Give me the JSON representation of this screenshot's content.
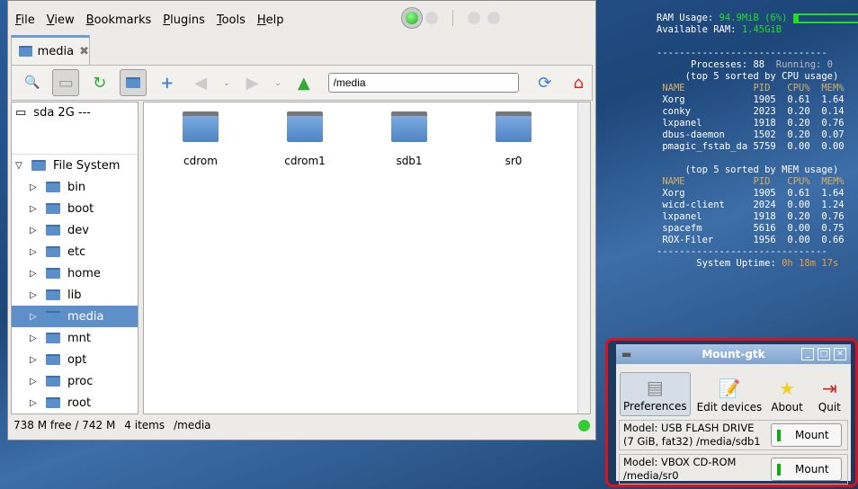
{
  "filemanager": {
    "menu": [
      "File",
      "View",
      "Bookmarks",
      "Plugins",
      "Tools",
      "Help"
    ],
    "tab_label": "media",
    "path": "/media",
    "sidebar_device": "sda 2G ---",
    "tree_root": "File System",
    "tree": [
      "bin",
      "boot",
      "dev",
      "etc",
      "home",
      "lib",
      "media",
      "mnt",
      "opt",
      "proc",
      "root"
    ],
    "selected": "media",
    "items": [
      "cdrom",
      "cdrom1",
      "sdb1",
      "sr0"
    ],
    "status": {
      "free": "738 M free / 742 M",
      "count": "4 items",
      "path": "/media"
    }
  },
  "conky": {
    "ram_label": "RAM Usage:",
    "ram_value": "94.9MiB (6%)",
    "ram_fraction": 0.06,
    "avail_label": "Available RAM:",
    "avail_value": "1.45GiB",
    "processes": "Processes: 88",
    "running": "Running: 0",
    "cpu_header": "(top 5 sorted by CPU usage)",
    "mem_header": "(top 5 sorted by MEM usage)",
    "columns": [
      "NAME",
      "PID",
      "CPU%",
      "MEM%"
    ],
    "cpu_rows": [
      [
        "Xorg",
        "1905",
        "0.61",
        "1.64"
      ],
      [
        "conky",
        "2023",
        "0.20",
        "0.14"
      ],
      [
        "lxpanel",
        "1918",
        "0.20",
        "0.76"
      ],
      [
        "dbus-daemon",
        "1502",
        "0.20",
        "0.07"
      ],
      [
        "pmagic_fstab_da",
        "5759",
        "0.00",
        "0.00"
      ]
    ],
    "mem_rows": [
      [
        "Xorg",
        "1905",
        "0.61",
        "1.64"
      ],
      [
        "wicd-client",
        "2024",
        "0.00",
        "1.24"
      ],
      [
        "lxpanel",
        "1918",
        "0.20",
        "0.76"
      ],
      [
        "spacefm",
        "5616",
        "0.00",
        "0.75"
      ],
      [
        "ROX-Filer",
        "1956",
        "0.00",
        "0.66"
      ]
    ],
    "uptime_label": "System Uptime:",
    "uptime_value": "0h 18m 17s"
  },
  "mount": {
    "title": "Mount-gtk",
    "tools": [
      "Preferences",
      "Edit devices",
      "About",
      "Quit"
    ],
    "devices": [
      {
        "line1": "Model:  USB FLASH DRIVE",
        "line2": "(7 GiB, fat32)   /media/sdb1",
        "button": "Mount"
      },
      {
        "line1": "Model: VBOX CD-ROM",
        "line2": "/media/sr0",
        "button": "Mount"
      }
    ]
  }
}
